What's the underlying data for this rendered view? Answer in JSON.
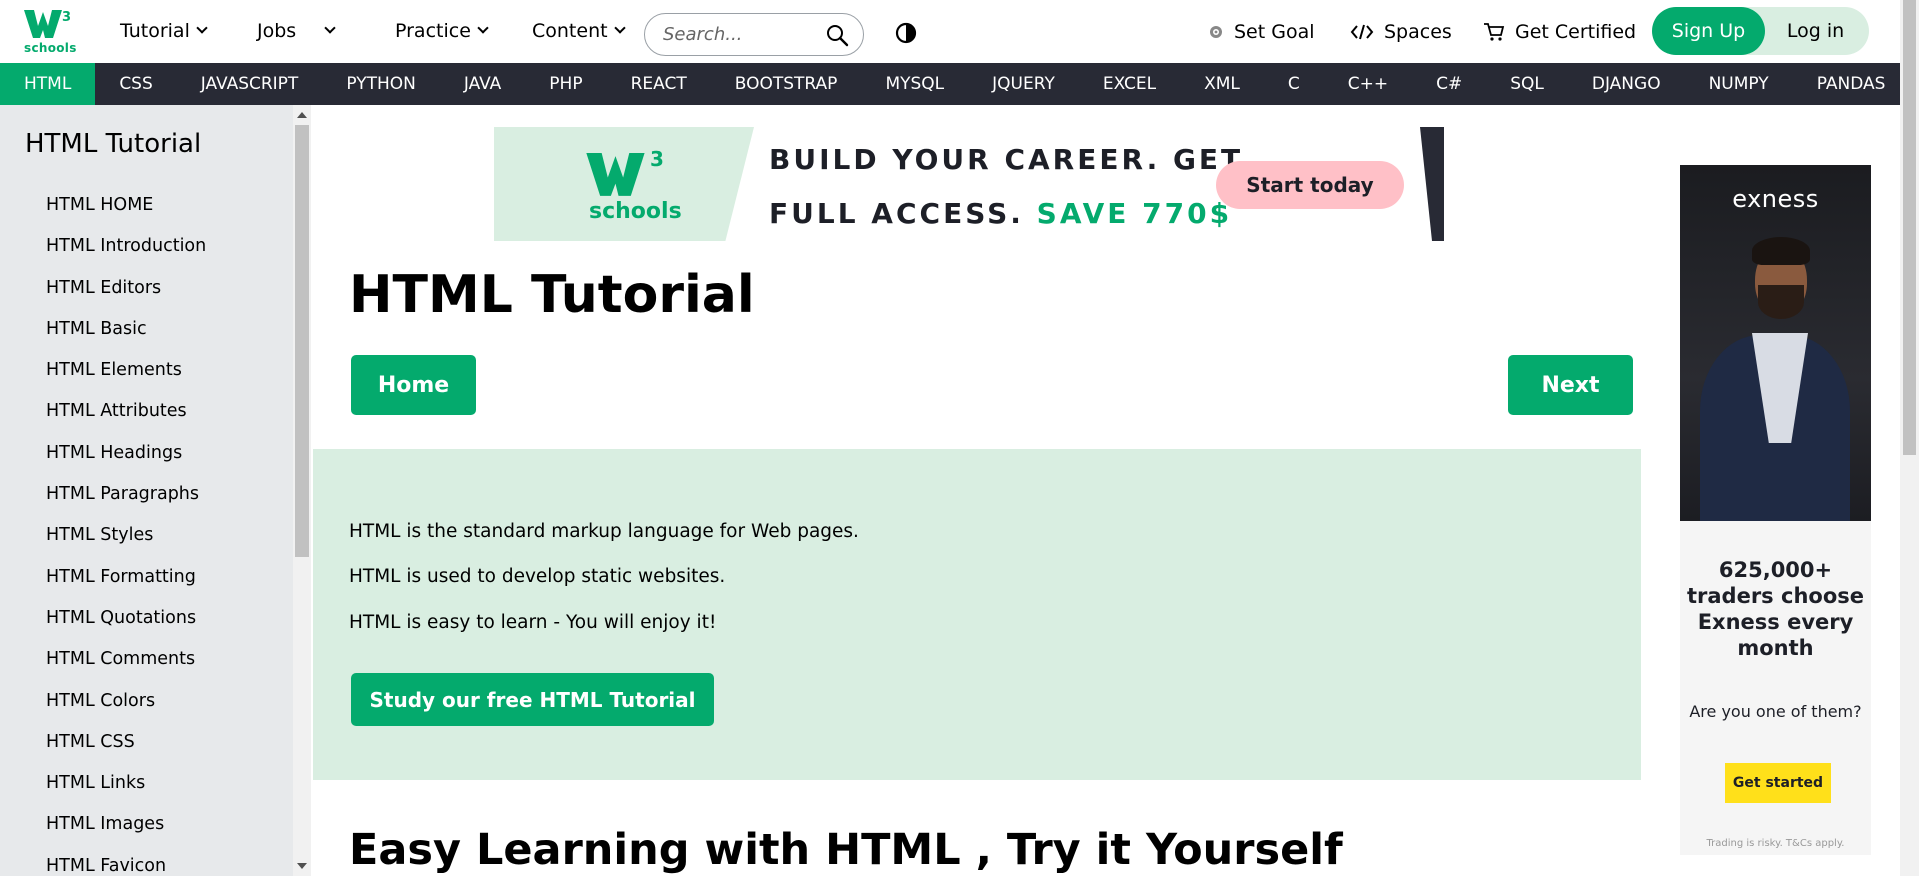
{
  "logo": {
    "three": "3",
    "schools": "schools"
  },
  "topnav": {
    "tutorial": "Tutorial",
    "jobs": "Jobs",
    "practice": "Practice",
    "content": "Content",
    "search_placeholder": "Search...",
    "set_goal": "Set Goal",
    "spaces": "Spaces",
    "get_certified": "Get Certified",
    "sign_up": "Sign Up",
    "log_in": "Log in"
  },
  "subjects": [
    "HTML",
    "CSS",
    "JAVASCRIPT",
    "PYTHON",
    "JAVA",
    "PHP",
    "REACT",
    "BOOTSTRAP",
    "MYSQL",
    "JQUERY",
    "EXCEL",
    "XML",
    "C",
    "C++",
    "C#",
    "SQL",
    "DJANGO",
    "NUMPY",
    "PANDAS"
  ],
  "sidebar": {
    "title": "HTML Tutorial",
    "items": [
      "HTML HOME",
      "HTML Introduction",
      "HTML Editors",
      "HTML Basic",
      "HTML Elements",
      "HTML Attributes",
      "HTML Headings",
      "HTML Paragraphs",
      "HTML Styles",
      "HTML Formatting",
      "HTML Quotations",
      "HTML Comments",
      "HTML Colors",
      "HTML CSS",
      "HTML Links",
      "HTML Images",
      "HTML Favicon"
    ]
  },
  "banner": {
    "logo_three": "3",
    "logo_schools": "schools",
    "line1": "BUILD YOUR CAREER. GET",
    "line2_prefix": "FULL ACCESS. ",
    "line2_save": "SAVE 770$",
    "cta": "Start today"
  },
  "main": {
    "title": "HTML Tutorial",
    "home_button": "Home",
    "next_button": "Next",
    "intro": [
      "HTML is the standard markup language for Web pages.",
      "HTML is used to develop static websites.",
      "HTML is easy to learn - You will enjoy it!"
    ],
    "study_button": "Study our free HTML Tutorial",
    "h2": "Easy Learning with HTML , Try it Yourself"
  },
  "ad": {
    "brand": "exness",
    "headline": "625,000+ traders choose Exness every month",
    "sub": "Are you one of them?",
    "cta": "Get started",
    "fine": "Trading is risky. T&Cs apply."
  },
  "colors": {
    "accent": "#04aa6d",
    "dark": "#282a35",
    "light_green": "#d9eee1",
    "sidebar": "#e7e9eb"
  }
}
